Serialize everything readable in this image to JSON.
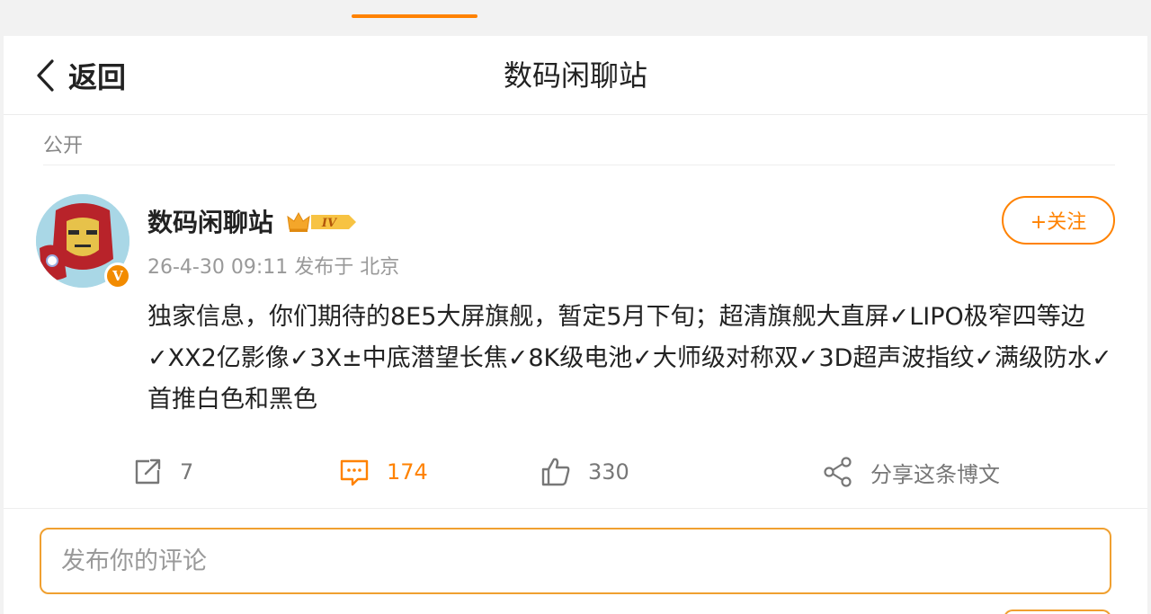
{
  "header": {
    "back_label": "返回",
    "title": "数码闲聊站"
  },
  "visibility": "公开",
  "post": {
    "username": "数码闲聊站",
    "rank_badge": "IV",
    "verified_badge": "V",
    "timestamp": "26-4-30 09:11",
    "location": "发布于 北京",
    "follow_label": "+关注",
    "content": "独家信息，你们期待的8E5大屏旗舰，暂定5月下旬；超清旗舰大直屏✓LIPO极窄四等边✓XX2亿影像✓3X±中底潜望长焦✓8K级电池✓大师级对称双✓3D超声波指纹✓满级防水✓首推白色和黑色"
  },
  "actions": {
    "repost_count": "7",
    "comment_count": "174",
    "like_count": "330",
    "share_label": "分享这条博文"
  },
  "comment_box": {
    "placeholder": "发布你的评论"
  },
  "colors": {
    "accent": "#ff8200",
    "text": "#222222",
    "muted": "#999999"
  }
}
